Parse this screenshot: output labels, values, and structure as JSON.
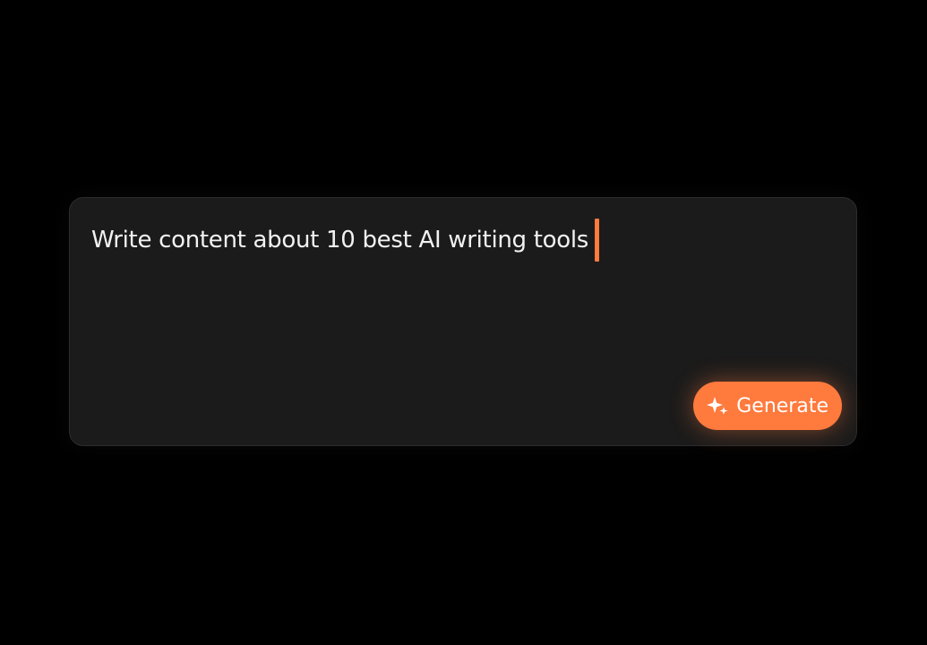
{
  "prompt": {
    "text": "Write content about 10 best AI writing tools"
  },
  "actions": {
    "generate_label": "Generate",
    "generate_icon": "sparkle-icon"
  },
  "colors": {
    "background": "#000000",
    "card": "#1b1b1b",
    "accent": "#ff7a3d",
    "text": "#f2f2f2"
  }
}
